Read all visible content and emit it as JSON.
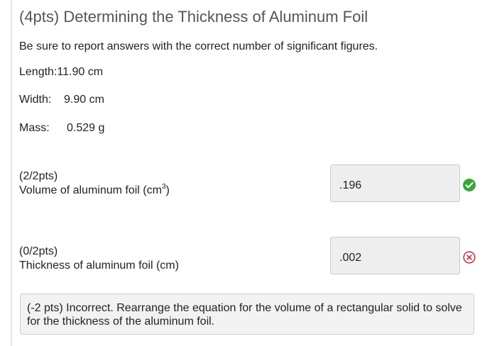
{
  "title": "(4pts) Determining the Thickness of Aluminum Foil",
  "instructions": "Be sure to report answers with the correct number of significant figures.",
  "measurements": {
    "length": {
      "label": "Length:",
      "value": "11.90 cm"
    },
    "width": {
      "label": "Width:",
      "value": "9.90 cm"
    },
    "mass": {
      "label": "Mass:",
      "value": "0.529 g"
    }
  },
  "questions": [
    {
      "points": "(2/2pts)",
      "label_main": "Volume of aluminum foil (cm",
      "label_sup": "3",
      "label_end": ")",
      "answer": ".196",
      "status": "correct",
      "status_color": "#3aa63a"
    },
    {
      "points": "(0/2pts)",
      "label_main": "Thickness of aluminum foil (cm)",
      "answer": ".002",
      "status": "incorrect",
      "status_color": "#c8344a"
    }
  ],
  "feedback": "(-2 pts) Incorrect. Rearrange the equation for the volume of a rectangular solid to solve for the thickness of the aluminum foil."
}
